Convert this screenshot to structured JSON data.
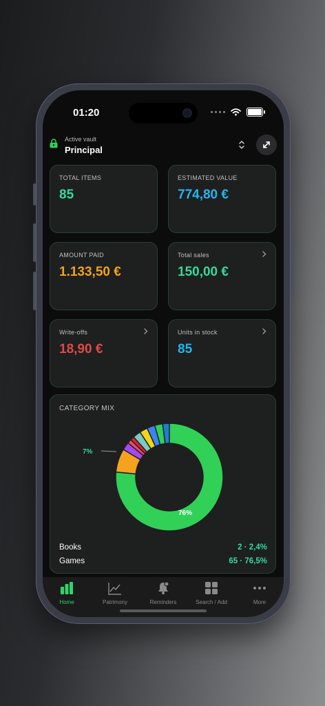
{
  "status": {
    "time": "01:20"
  },
  "vault": {
    "label": "Active vault",
    "name": "Principal"
  },
  "cards": [
    {
      "label": "TOTAL ITEMS",
      "value": "85",
      "color": "#35d999"
    },
    {
      "label": "ESTIMATED VALUE",
      "value": "774,80 €",
      "color": "#22b5f0"
    },
    {
      "label": "AMOUNT PAID",
      "value": "1.133,50 €",
      "color": "#f5a21b"
    },
    {
      "label": "Total sales",
      "value": "150,00 €",
      "color": "#35d999"
    },
    {
      "label": "Write-offs",
      "value": "18,90 €",
      "color": "#e04a46"
    },
    {
      "label": "Units in stock",
      "value": "85",
      "color": "#22b5f0"
    }
  ],
  "category_mix": {
    "title": "CATEGORY MIX",
    "big_label": "76%",
    "small_label": "7%",
    "slices": [
      {
        "value": 76.5,
        "color": "#31d158"
      },
      {
        "value": 7.1,
        "color": "#f5a31c"
      },
      {
        "value": 2.4,
        "color": "#a349f0"
      },
      {
        "value": 1.2,
        "color": "#f04a6f"
      },
      {
        "value": 1.2,
        "color": "#e1242b"
      },
      {
        "value": 2.4,
        "color": "#7cc8c6"
      },
      {
        "value": 2.4,
        "color": "#f3d418"
      },
      {
        "value": 2.4,
        "color": "#3b84f5"
      },
      {
        "value": 2.4,
        "color": "#31d158"
      },
      {
        "value": 2.0,
        "color": "#1a7fd4"
      }
    ],
    "legend": [
      {
        "name": "Books",
        "value": "2 · 2,4%"
      },
      {
        "name": "Games",
        "value": "65 · 76,5%"
      }
    ]
  },
  "tabs": [
    {
      "label": "Home",
      "icon": "bar-chart-icon"
    },
    {
      "label": "Patrimony",
      "icon": "trend-line-icon"
    },
    {
      "label": "Reminders",
      "icon": "bell-icon"
    },
    {
      "label": "Search / Add",
      "icon": "grid-icon"
    },
    {
      "label": "More",
      "icon": "ellipsis-icon"
    }
  ]
}
